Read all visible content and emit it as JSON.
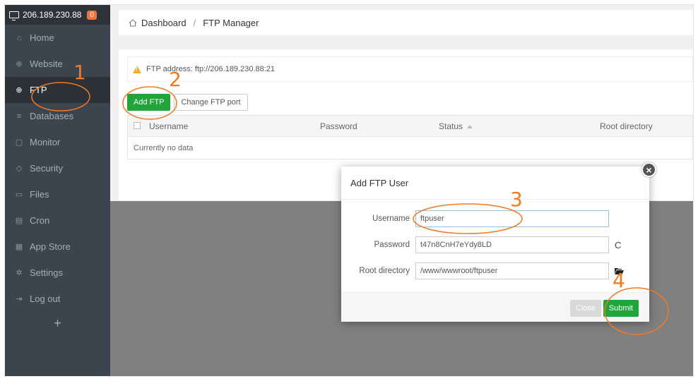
{
  "sidebar": {
    "host": "206.189.230.88",
    "badge": "0",
    "items": [
      {
        "label": "Home",
        "icon": "home-icon"
      },
      {
        "label": "Website",
        "icon": "globe-icon"
      },
      {
        "label": "FTP",
        "icon": "ftp-icon"
      },
      {
        "label": "Databases",
        "icon": "database-icon"
      },
      {
        "label": "Monitor",
        "icon": "monitor-icon"
      },
      {
        "label": "Security",
        "icon": "shield-icon"
      },
      {
        "label": "Files",
        "icon": "folder-icon"
      },
      {
        "label": "Cron",
        "icon": "calendar-icon"
      },
      {
        "label": "App Store",
        "icon": "grid-icon"
      },
      {
        "label": "Settings",
        "icon": "gear-icon"
      },
      {
        "label": "Log out",
        "icon": "logout-icon"
      }
    ],
    "active": "FTP",
    "plus": "+"
  },
  "breadcrumb": {
    "home": "Dashboard",
    "sep": "/",
    "current": "FTP Manager"
  },
  "ftp": {
    "address_label": "FTP address:",
    "address_value": "ftp://206.189.230.88:21",
    "add_button": "Add FTP",
    "port_button": "Change FTP port"
  },
  "table": {
    "columns": [
      "Username",
      "Password",
      "Status",
      "Root directory"
    ],
    "empty": "Currently no data"
  },
  "modal": {
    "title": "Add FTP User",
    "username_label": "Username",
    "username_value": "ftpuser",
    "password_label": "Password",
    "password_value": "t47n8CnH7eYdy8LD",
    "root_label": "Root directory",
    "root_value": "/www/wwwroot/ftpuser",
    "close_button": "Close",
    "submit_button": "Submit",
    "close_x": "×",
    "refresh_glyph": "C"
  },
  "annotations": {
    "n1": "1",
    "n2": "2",
    "n3": "3",
    "n4": "4"
  },
  "colors": {
    "accent": "#20a53a",
    "annotation": "#f07a22",
    "sidebar": "#3c444d"
  }
}
